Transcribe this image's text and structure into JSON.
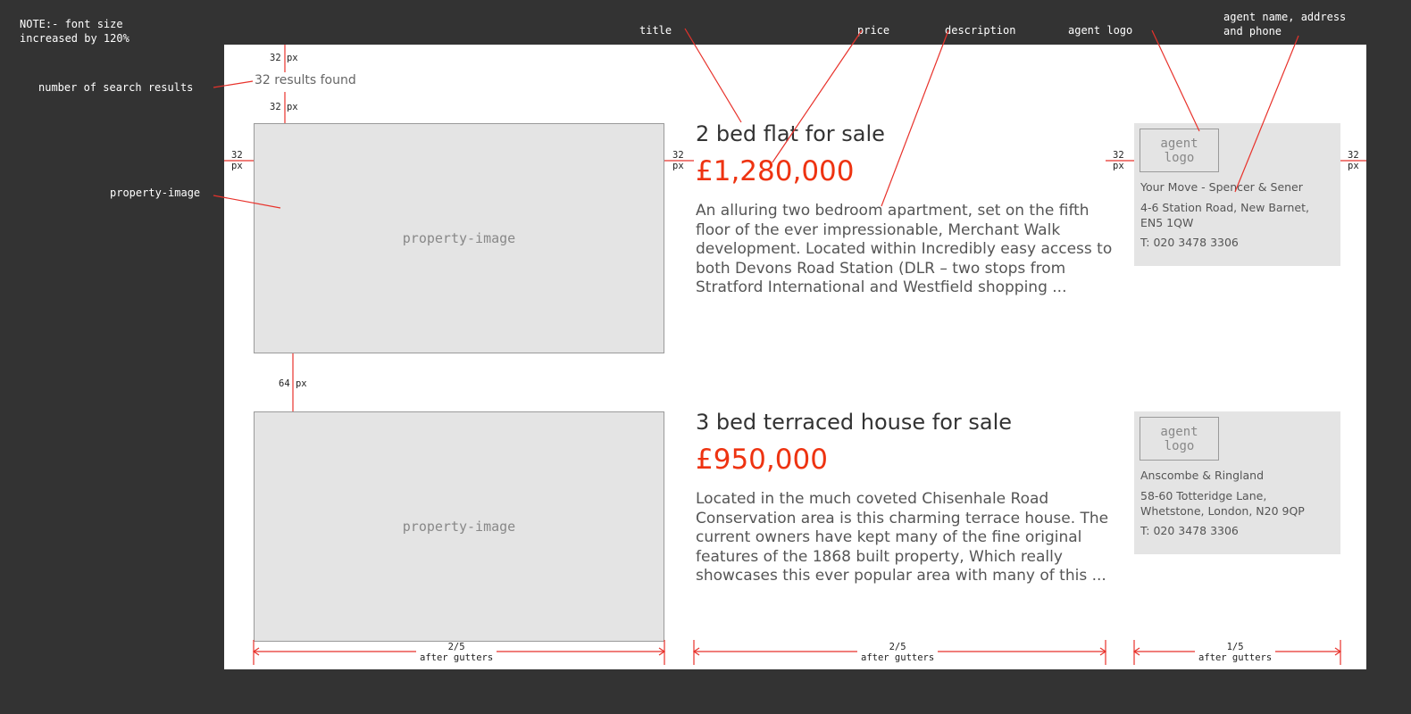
{
  "note": "NOTE:- font size\nincreased by 120%",
  "annotations": {
    "title": "title",
    "price": "price",
    "description": "description",
    "agent_logo": "agent logo",
    "agent_details": "agent name, address\nand phone",
    "search_results": "number of search results",
    "property_image": "property-image"
  },
  "results_text": "32 results found",
  "listings": [
    {
      "image_placeholder": "property-image",
      "title": "2 bed flat for sale",
      "price": "£1,280,000",
      "description": "An alluring two bedroom apartment, set on the fifth floor of the ever impressionable, Merchant Walk development. Located within Incredibly easy access to both Devons Road Station (DLR – two stops from Stratford International and Westfield shopping ...",
      "agent": {
        "logo": "agent\nlogo",
        "name": "Your Move - Spencer & Sener",
        "address": "4-6 Station Road, New Barnet,\nEN5 1QW",
        "phone": "T: 020 3478 3306"
      }
    },
    {
      "image_placeholder": "property-image",
      "title": "3 bed terraced house for sale",
      "price": "£950,000",
      "description": "Located in the much coveted Chisenhale Road Conservation area is this charming terrace house. The current owners have kept many of the fine original features of the 1868 built property, Which really showcases this ever popular area with many of this ...",
      "agent": {
        "logo": "agent\nlogo",
        "name": "Anscombe & Ringland",
        "address": "58-60 Totteridge Lane,\nWhetstone, London, N20 9QP",
        "phone": "T: 020 3478 3306"
      }
    }
  ],
  "dimensions": {
    "top_gap": "32 px",
    "results_gap": "32 px",
    "gutter_label": "32\npx",
    "row_gap": "64 px",
    "col1": "2/5\nafter gutters",
    "col2": "2/5\nafter gutters",
    "col3": "1/5\nafter gutters"
  },
  "colors": {
    "background": "#333333",
    "canvas": "#ffffff",
    "price": "#ee3311",
    "annotation_line": "#e8322b",
    "placeholder": "#e4e4e4"
  }
}
